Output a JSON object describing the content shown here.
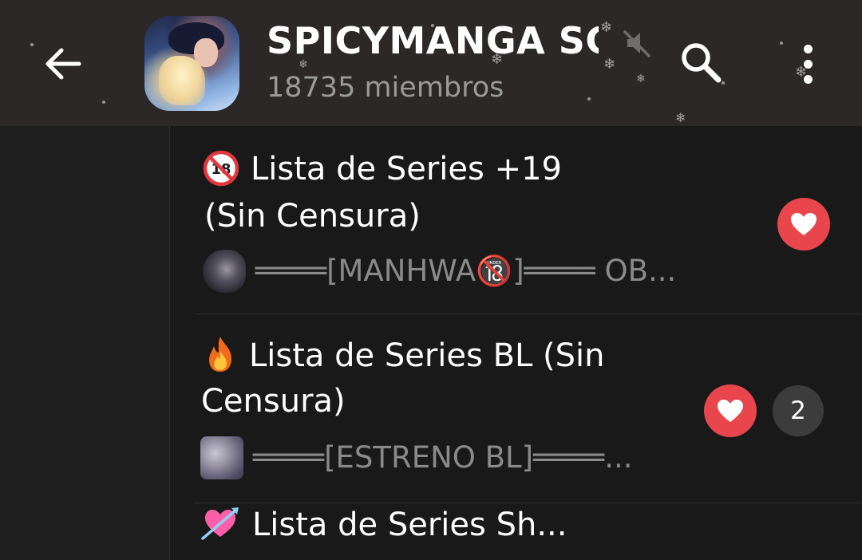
{
  "header": {
    "title": "SPICYMANGA SCA",
    "members": "18735 miembros",
    "icons": {
      "back": "arrow-left-icon",
      "avatar": "group-avatar",
      "mute": "muted-speaker-icon",
      "search": "search-icon",
      "more": "more-vertical-icon"
    }
  },
  "topics": [
    {
      "emoji": "no-under-18-emoji",
      "title_line1": "Lista de Series +19",
      "title_line2": "(Sin Censura)",
      "preview": "════[MANHWA🔞]════ OB...",
      "reaction": "heart",
      "count": ""
    },
    {
      "emoji": "fire-emoji",
      "title_line1": "Lista de Series BL (Sin",
      "title_line2": "Censura)",
      "preview": "════[ESTRENO BL]════...",
      "reaction": "heart",
      "count": "2"
    },
    {
      "emoji": "heart-with-arrow-emoji",
      "title_line1": "Lista de Series Sh...",
      "title_line2": "",
      "preview": "",
      "reaction": "",
      "count": ""
    }
  ],
  "colors": {
    "header_bg": "#2b2827",
    "list_bg": "#191919",
    "accent_red": "#e9454c",
    "muted_text": "#8a8a8a",
    "count_badge_bg": "#3c3c3c"
  }
}
